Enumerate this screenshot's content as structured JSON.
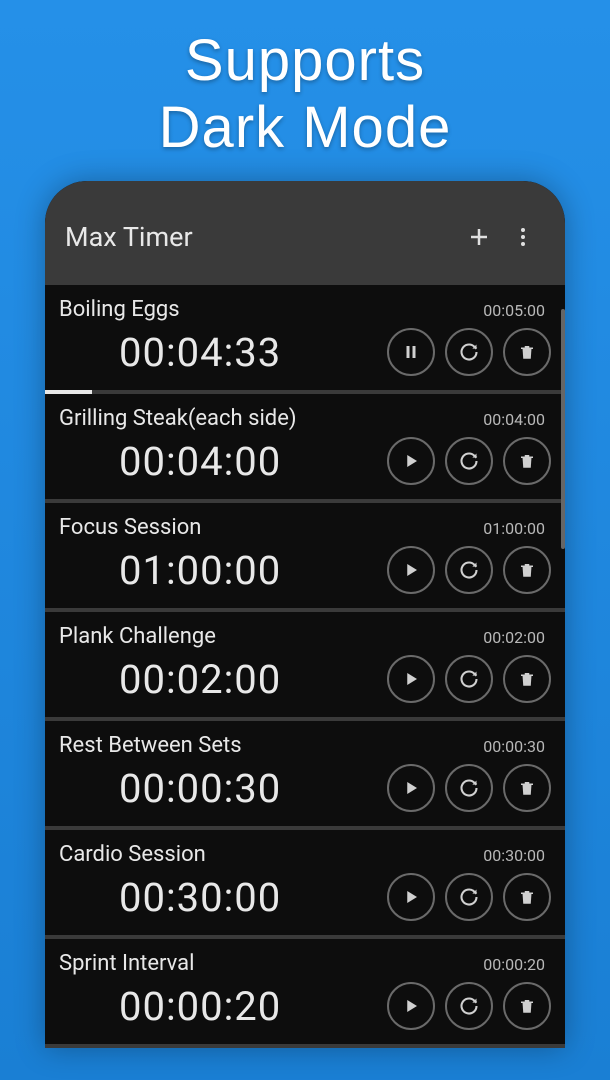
{
  "promo": {
    "line1": "Supports",
    "line2": "Dark Mode"
  },
  "header": {
    "title": "Max Timer"
  },
  "timers": [
    {
      "name": "Boiling Eggs",
      "total": "00:05:00",
      "current": "00:04:33",
      "state": "running",
      "progress": 9
    },
    {
      "name": "Grilling Steak(each side)",
      "total": "00:04:00",
      "current": "00:04:00",
      "state": "paused",
      "progress": 0
    },
    {
      "name": "Focus Session",
      "total": "01:00:00",
      "current": "01:00:00",
      "state": "paused",
      "progress": 0
    },
    {
      "name": "Plank Challenge",
      "total": "00:02:00",
      "current": "00:02:00",
      "state": "paused",
      "progress": 0
    },
    {
      "name": "Rest Between Sets",
      "total": "00:00:30",
      "current": "00:00:30",
      "state": "paused",
      "progress": 0
    },
    {
      "name": "Cardio Session",
      "total": "00:30:00",
      "current": "00:30:00",
      "state": "paused",
      "progress": 0
    },
    {
      "name": "Sprint Interval",
      "total": "00:00:20",
      "current": "00:00:20",
      "state": "paused",
      "progress": 0
    }
  ]
}
